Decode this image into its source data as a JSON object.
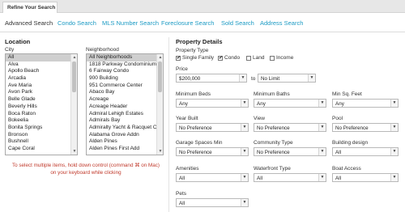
{
  "header": {
    "tab_title": "Refine Your Search"
  },
  "search_tabs": [
    {
      "label": "Advanced Search"
    },
    {
      "label": "Condo Search"
    },
    {
      "label": "MLS Number Search"
    },
    {
      "label": "Foreclosure Search"
    },
    {
      "label": "Sold Search"
    },
    {
      "label": "Address Search"
    }
  ],
  "location": {
    "title": "Location",
    "city_label": "City",
    "neighborhood_label": "Neighborhood",
    "cities": [
      "All",
      "Alva",
      "Apollo Beach",
      "Arcadia",
      "Ave Maria",
      "Avon Park",
      "Belle Glade",
      "Beverly Hills",
      "Boca Raton",
      "Bokeelia",
      "Bonita Springs",
      "Bronson",
      "Bushnell",
      "Cape Coral"
    ],
    "neighborhoods": [
      "All Neighborhoods",
      "1818 Parkway Condominium",
      "6 Fairway Condo",
      "900 Building",
      "951 Commerce Center",
      "Abaco Bay",
      "Acreage",
      "Acreage Header",
      "Admiral Lehigh Estates",
      "Admirals Bay",
      "Admiralty Yacht & Racquet C",
      "Alabama Grove Addn",
      "Alden Pines",
      "Alden Pines First Add"
    ],
    "help_line1": "To select multiple items, hold down control (command ⌘ on Mac)",
    "help_line2": "on your keyboard while clicking"
  },
  "property": {
    "title": "Property Details",
    "type_label": "Property Type",
    "types": [
      {
        "label": "Single Family",
        "checked": "✔"
      },
      {
        "label": "Condo",
        "checked": "✔"
      },
      {
        "label": "Land",
        "checked": ""
      },
      {
        "label": "Income",
        "checked": ""
      }
    ],
    "price_label": "Price",
    "price_min": "$200,000",
    "price_to": "to",
    "price_max": "No Limit",
    "fields": [
      {
        "label": "Minimum Beds",
        "value": "Any"
      },
      {
        "label": "Minimum Baths",
        "value": "Any"
      },
      {
        "label": "Min Sq. Feet",
        "value": "Any"
      },
      {
        "label": "Year Built",
        "value": "No Preference"
      },
      {
        "label": "View",
        "value": "No Preference"
      },
      {
        "label": "Pool",
        "value": "No Preference"
      },
      {
        "label": "Garage Spaces Min",
        "value": "No Preference"
      },
      {
        "label": "Community Type",
        "value": "No Preference"
      },
      {
        "label": "Building design",
        "value": "All"
      },
      {
        "label": "Amenities",
        "value": "All"
      },
      {
        "label": "Waterfront Type",
        "value": "All"
      },
      {
        "label": "Boat Access",
        "value": "All"
      },
      {
        "label": "Pets",
        "value": "All"
      }
    ]
  }
}
